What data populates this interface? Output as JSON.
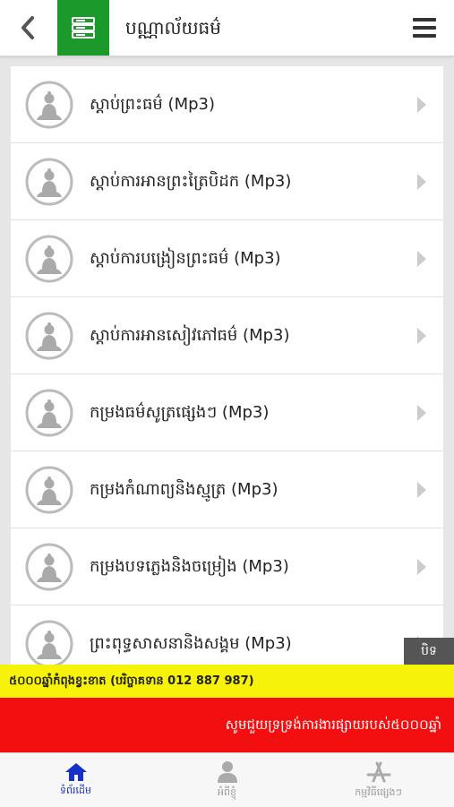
{
  "header": {
    "title": "បណ្ណាល័យធម៌",
    "back_icon": "chevron-left-icon",
    "section_icon": "server-list-icon",
    "menu_icon": "hamburger-menu-icon",
    "accent_color": "#1b9a2b"
  },
  "list": {
    "items": [
      {
        "label": "ស្តាប់ព្រះធម៌ (Mp3)"
      },
      {
        "label": "ស្តាប់ការអានព្រះត្រៃបិដក (Mp3)"
      },
      {
        "label": "ស្តាប់ការបង្រៀនព្រះធម៌ (Mp3)"
      },
      {
        "label": "ស្តាប់ការអានសៀវភៅធម៌ (Mp3)"
      },
      {
        "label": "កម្រងធម៌សូត្រផ្សេងៗ (Mp3)"
      },
      {
        "label": "កម្រងកំណាព្យនិងស្មូត្រ (Mp3)"
      },
      {
        "label": "កម្រងបទភ្លេងនិងចម្រៀង (Mp3)"
      },
      {
        "label": "ព្រះពុទ្ធសាសនានិងសង្គម (Mp3)"
      }
    ]
  },
  "close_tab": {
    "label": "បិទ"
  },
  "banner": {
    "yellow_text": "៥០០០ឆ្នាំកំពុងខ្វះខាត (បរិច្ចាគទាន 012 887 987)",
    "red_text": "សូមជួយទ្រទ្រង់ការងារផ្សាយរបស់៥០០០ឆ្នាំ",
    "yellow_color": "#f7f20a",
    "red_color": "#f30f0f"
  },
  "tabs": [
    {
      "label": "ទំព័រដើម",
      "icon": "home-icon",
      "active": true
    },
    {
      "label": "អំពីខ្ញុំ",
      "icon": "user-icon",
      "active": false
    },
    {
      "label": "កម្មវិធីផ្សេងៗ",
      "icon": "app-store-icon",
      "active": false
    }
  ]
}
